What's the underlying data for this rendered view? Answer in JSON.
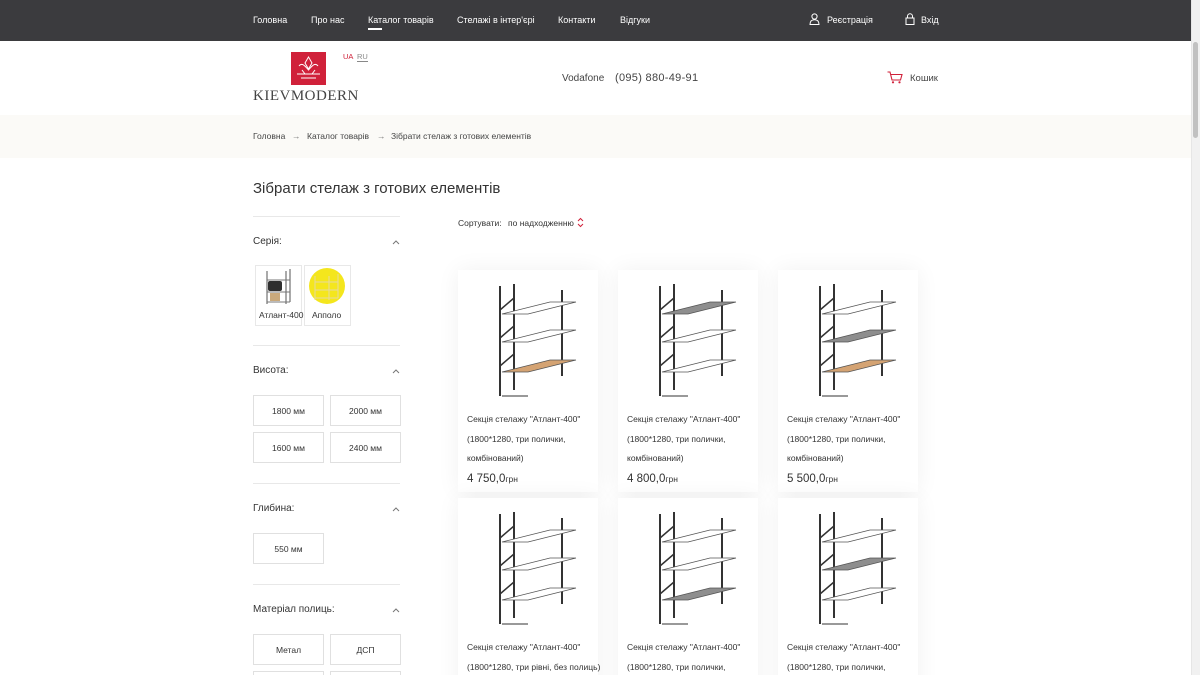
{
  "nav": {
    "items": [
      "Головна",
      "Про нас",
      "Каталог товарів",
      "Стелажі в інтер'єрі",
      "Контакти",
      "Відгуки"
    ],
    "register": "Реєстрація",
    "login": "Вхід"
  },
  "header": {
    "logo_text": "KIEVMODERN",
    "languages": [
      "UA",
      "RU"
    ],
    "operator": "Vodafone",
    "phone": "(095) 880-49-91",
    "cart": "Кошик"
  },
  "breadcrumb": [
    "Головна",
    "Каталог товарів",
    "Зібрати стелаж з готових елементів"
  ],
  "page_title": "Зібрати стелаж з готових елементів",
  "filters": {
    "series": {
      "title": "Серія:",
      "options": [
        "Атлант-400",
        "Апполо"
      ]
    },
    "height": {
      "title": "Висота:",
      "options": [
        "1800 мм",
        "2000 мм",
        "1600 мм",
        "2400 мм"
      ]
    },
    "depth": {
      "title": "Глибина:",
      "options": [
        "550 мм"
      ]
    },
    "material": {
      "title": "Матеріал полиць:",
      "options": [
        "Метал",
        "ДСП"
      ]
    }
  },
  "sort": {
    "label": "Сортувати:",
    "value": "по надходженню"
  },
  "products": [
    {
      "name": "Секція стелажу \"Атлант-400\" (1800*1280, три полички, комбінований)",
      "price": "4 750,0",
      "currency": "грн",
      "shelves": [
        "glass",
        "glass",
        "wood"
      ]
    },
    {
      "name": "Секція стелажу \"Атлант-400\" (1800*1280, три полички, комбінований)",
      "price": "4 800,0",
      "currency": "грн",
      "shelves": [
        "metal",
        "glass",
        "glass"
      ]
    },
    {
      "name": "Секція стелажу \"Атлант-400\" (1800*1280, три полички, комбінований)",
      "price": "5 500,0",
      "currency": "грн",
      "shelves": [
        "glass",
        "metal",
        "wood"
      ]
    },
    {
      "name": "Секція стелажу \"Атлант-400\" (1800*1280, три рівні, без полиць)",
      "price": "",
      "currency": "",
      "shelves": [
        "glass",
        "glass",
        "glass"
      ]
    },
    {
      "name": "Секція стелажу \"Атлант-400\" (1800*1280, три полички,",
      "price": "",
      "currency": "",
      "shelves": [
        "glass",
        "glass",
        "metal"
      ]
    },
    {
      "name": "Секція стелажу \"Атлант-400\" (1800*1280, три полички,",
      "price": "",
      "currency": "",
      "shelves": [
        "glass",
        "metal",
        "glass"
      ]
    }
  ],
  "colors": {
    "nav_bg": "#3b3b3e",
    "accent": "#d0213a",
    "wood": "#d4a373",
    "metal": "#8e8e8e"
  }
}
